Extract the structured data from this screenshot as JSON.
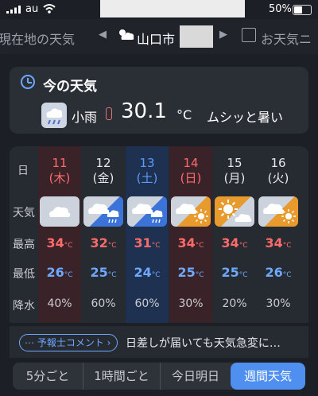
{
  "status_bar": {
    "carrier": "au",
    "battery": "50%"
  },
  "nav": {
    "prev_location": "現在地の天気",
    "current_location": "山口市",
    "next_label": "お天気ニ"
  },
  "current": {
    "title": "今の天気",
    "condition": "小雨",
    "temperature": "30.1",
    "unit": "°C",
    "description": "ムシッと暑い"
  },
  "weekly": {
    "row_labels": {
      "day": "日",
      "weather": "天気",
      "high": "最高",
      "low": "最低",
      "precip": "降水"
    },
    "temp_unit": "°C",
    "days": [
      {
        "date": "11",
        "weekday": "(木)",
        "high": "34",
        "low": "26",
        "pop": "40%",
        "weather_icon": "cloudy-icon"
      },
      {
        "date": "12",
        "weekday": "(金)",
        "high": "32",
        "low": "25",
        "pop": "60%",
        "weather_icon": "cloudy-rain-icon"
      },
      {
        "date": "13",
        "weekday": "(土)",
        "high": "31",
        "low": "24",
        "pop": "60%",
        "weather_icon": "cloudy-rain-icon"
      },
      {
        "date": "14",
        "weekday": "(日)",
        "high": "34",
        "low": "25",
        "pop": "30%",
        "weather_icon": "cloudy-sunny-icon"
      },
      {
        "date": "15",
        "weekday": "(月)",
        "high": "34",
        "low": "25",
        "pop": "20%",
        "weather_icon": "sunny-cloudy-icon"
      },
      {
        "date": "16",
        "weekday": "(火)",
        "high": "34",
        "low": "26",
        "pop": "30%",
        "weather_icon": "cloudy-sunny-icon"
      }
    ]
  },
  "comment": {
    "chip": "予報士コメント",
    "text": "日差しが届いても天気急変に…"
  },
  "tabs": [
    "5分ごと",
    "1時間ごと",
    "今日明日",
    "週間天気"
  ],
  "colors": {
    "accent": "#4e8ff0",
    "saturday": "#5b9bff",
    "holiday": "#ff6b6b",
    "high": "#ff6b6b",
    "low": "#6ea8ff"
  }
}
